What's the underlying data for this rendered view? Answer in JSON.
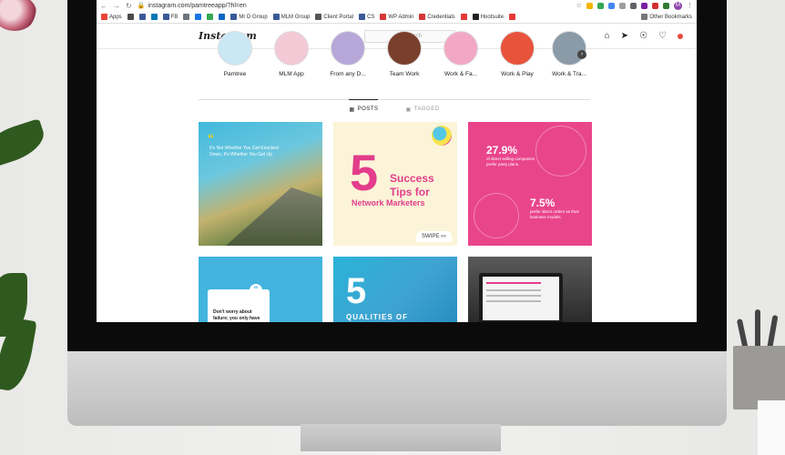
{
  "browser": {
    "url": "instagram.com/pamtreeapp/?hl=en",
    "profile_initial": "M"
  },
  "bookmarks": [
    {
      "label": "Apps",
      "color": "#ea4335"
    },
    {
      "label": "",
      "color": "#4a4a4a"
    },
    {
      "label": "",
      "color": "#3b5998"
    },
    {
      "label": "",
      "color": "#0077b5"
    },
    {
      "label": "FB",
      "color": "#3b5998"
    },
    {
      "label": "",
      "color": "#6c757d"
    },
    {
      "label": "",
      "color": "#1a73e8"
    },
    {
      "label": "",
      "color": "#34a853"
    },
    {
      "label": "",
      "color": "#0a66c2"
    },
    {
      "label": "Mr D Group",
      "color": "#3b5998"
    },
    {
      "label": "MLM Group",
      "color": "#3b5998"
    },
    {
      "label": "Client Portal",
      "color": "#555555"
    },
    {
      "label": "CS",
      "color": "#3b5998"
    },
    {
      "label": "WP Admin",
      "color": "#d63638"
    },
    {
      "label": "Credentials",
      "color": "#d63638"
    },
    {
      "label": "",
      "color": "#e53935"
    },
    {
      "label": "Hootsuite",
      "color": "#222222"
    },
    {
      "label": "",
      "color": "#e53935"
    }
  ],
  "other_bookmarks": "Other Bookmarks",
  "instagram": {
    "logo": "Instagram",
    "search_placeholder": "Search"
  },
  "highlights": [
    {
      "label": "Pamtree",
      "color": "#c9e7f4"
    },
    {
      "label": "MLM App",
      "color": "#f3c9d6"
    },
    {
      "label": "From any D...",
      "color": "#b7a7d8"
    },
    {
      "label": "Team Work",
      "color": "#7a3f2c"
    },
    {
      "label": "Work & Fa...",
      "color": "#f2a8c4"
    },
    {
      "label": "Work & Play",
      "color": "#e8533b"
    },
    {
      "label": "Work & Tra...",
      "color": "#8a9aa7"
    }
  ],
  "tabs": [
    {
      "label": "POSTS",
      "active": true
    },
    {
      "label": "TAGGED",
      "active": false
    }
  ],
  "posts": {
    "p1": {
      "quote_mark": "“",
      "text": "It's Not Whether You Get Knocked Down, It's Whether You Get Up"
    },
    "p2": {
      "number": "5",
      "line1": "Success",
      "line2": "Tips for",
      "line3": "Network Marketers",
      "swipe": "SWIPE"
    },
    "p3": {
      "pct1": "27.9%",
      "desc1": "of direct selling companies prefer party plans.",
      "pct2": "7.5%",
      "desc2": "prefer direct orders as their business models."
    },
    "p4": {
      "quote_mark": "“",
      "text": "Don't worry about failure; you only have"
    },
    "p5": {
      "number": "5",
      "caption": "QUALITIES OF"
    },
    "p6": {}
  }
}
